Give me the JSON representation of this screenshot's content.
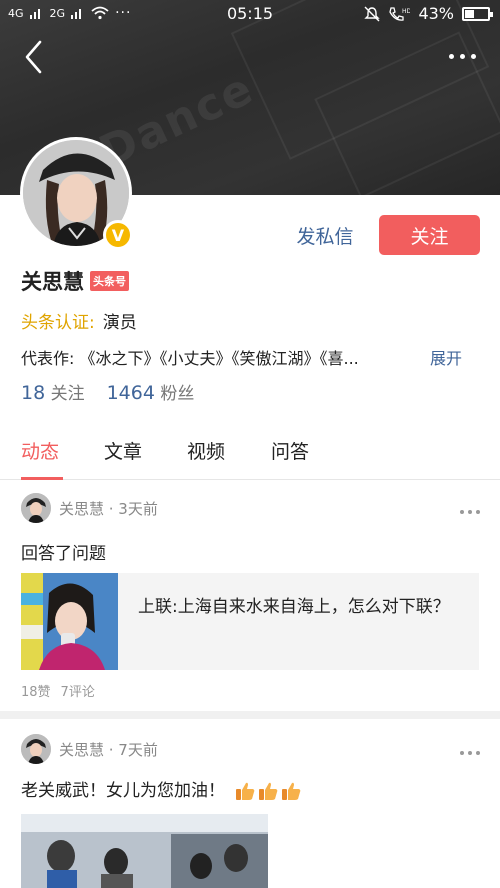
{
  "status_bar": {
    "signal_left": "4G",
    "signal_right": "2G",
    "time": "05:15",
    "battery_percent": "43%",
    "battery_level": 0.43
  },
  "profile": {
    "name": "关思慧",
    "badge": "头条号",
    "cert_label": "头条认证:",
    "cert_value": "演员",
    "works_label": "代表作:",
    "works_value": "《冰之下》《小丈夫》《笑傲江湖》《喜...",
    "expand": "展开",
    "following_count": "18",
    "following_label": "关注",
    "fans_count": "1464",
    "fans_label": "粉丝",
    "verified_mark": "V"
  },
  "actions": {
    "message": "发私信",
    "follow": "关注"
  },
  "tabs": [
    {
      "label": "动态"
    },
    {
      "label": "文章"
    },
    {
      "label": "视频"
    },
    {
      "label": "问答"
    }
  ],
  "posts": [
    {
      "meta": "关思慧 · 3天前",
      "text": "回答了问题",
      "card_text": "上联:上海自来水来自海上，怎么对下联？",
      "likes": "18赞",
      "comments": "7评论"
    },
    {
      "meta": "关思慧 · 7天前",
      "text": "老关威武！女儿为您加油！"
    }
  ],
  "colors": {
    "accent_red": "#f25e5e",
    "link_blue": "#406599",
    "cert_gold": "#e0a400"
  }
}
